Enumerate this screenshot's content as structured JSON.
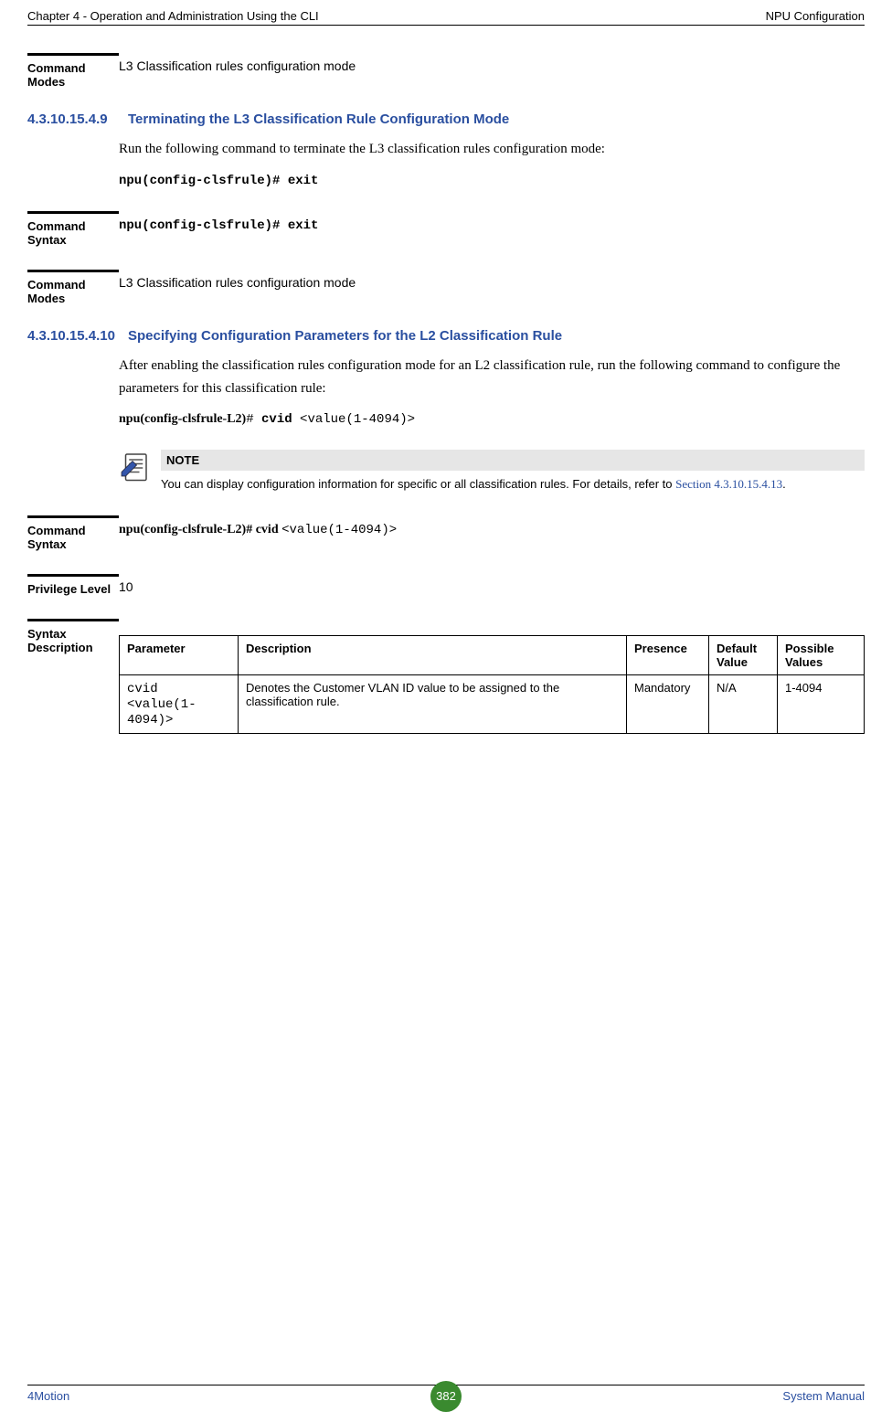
{
  "header": {
    "left": "Chapter 4 - Operation and Administration Using the CLI",
    "right": "NPU Configuration"
  },
  "block1": {
    "label": "Command Modes",
    "text": "L3 Classification rules configuration mode"
  },
  "sec1": {
    "num": "4.3.10.15.4.9",
    "title": "Terminating the L3 Classification Rule Configuration Mode",
    "body": "Run the following command to terminate the L3 classification rules configuration mode:",
    "cmd": "npu(config-clsfrule)# exit"
  },
  "block2": {
    "label": "Command Syntax",
    "text": "npu(config-clsfrule)# exit"
  },
  "block3": {
    "label": "Command Modes",
    "text": "L3 Classification rules configuration mode"
  },
  "sec2": {
    "num": "4.3.10.15.4.10",
    "title": "Specifying Configuration Parameters for the L2 Classification Rule",
    "body": "After enabling the classification rules configuration mode for an L2 classification rule, run the following command to configure the parameters for this classification rule:",
    "cmd_prefix": "npu(config-clsfrule-L2)",
    "cmd_mid": "# ",
    "cmd_kw": "cvid ",
    "cmd_arg": "<value(1-4094)>"
  },
  "note": {
    "title": "NOTE",
    "text_a": "You can display configuration information for specific or all classification rules. For details, refer to ",
    "link": "Section 4.3.10.15.4.13",
    "text_b": "."
  },
  "block4": {
    "label": "Command Syntax",
    "prefix": "npu(config-clsfrule-L2)# cvid ",
    "arg": "<value(1-4094)>"
  },
  "block5": {
    "label": "Privilege Level",
    "text": "10"
  },
  "block6": {
    "label": "Syntax Description"
  },
  "table": {
    "headers": [
      "Parameter",
      "Description",
      "Presence",
      "Default Value",
      "Possible Values"
    ],
    "row": {
      "param_a": "cvid",
      "param_b": "<value(1-4094)>",
      "desc": "Denotes the Customer VLAN ID value to be assigned to the classification rule.",
      "presence": "Mandatory",
      "default": "N/A",
      "possible": "1-4094"
    }
  },
  "footer": {
    "left": "4Motion",
    "page": "382",
    "right": "System Manual"
  }
}
